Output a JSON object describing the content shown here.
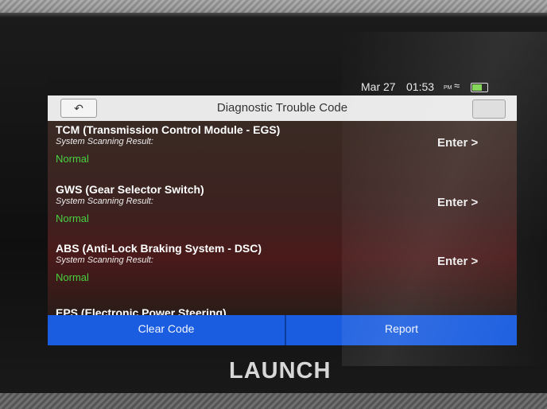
{
  "status_bar": {
    "date": "Mar 27",
    "time": "01:53",
    "ampm": "PM",
    "wifi_icon": "wifi-icon",
    "battery_icon": "battery-icon"
  },
  "title_bar": {
    "back_icon": "back-arrow-icon",
    "title": "Diagnostic Trouble Code"
  },
  "systems": [
    {
      "name": "TCM (Transmission Control Module - EGS)",
      "result_label": "System Scanning Result:",
      "result": "Normal",
      "action": "Enter >"
    },
    {
      "name": "GWS (Gear Selector Switch)",
      "result_label": "System Scanning Result:",
      "result": "Normal",
      "action": "Enter >"
    },
    {
      "name": "ABS (Anti-Lock Braking System - DSC)",
      "result_label": "System Scanning Result:",
      "result": "Normal",
      "action": "Enter >"
    },
    {
      "name": "EPS (Electronic Power Steering)"
    }
  ],
  "bottom_bar": {
    "clear_label": "Clear Code",
    "report_label": "Report"
  },
  "brand": "LAUNCH",
  "colors": {
    "normal_status": "#49d13f",
    "bottom_bar": "#1a5de0",
    "title_bar": "#e9e9e9"
  }
}
